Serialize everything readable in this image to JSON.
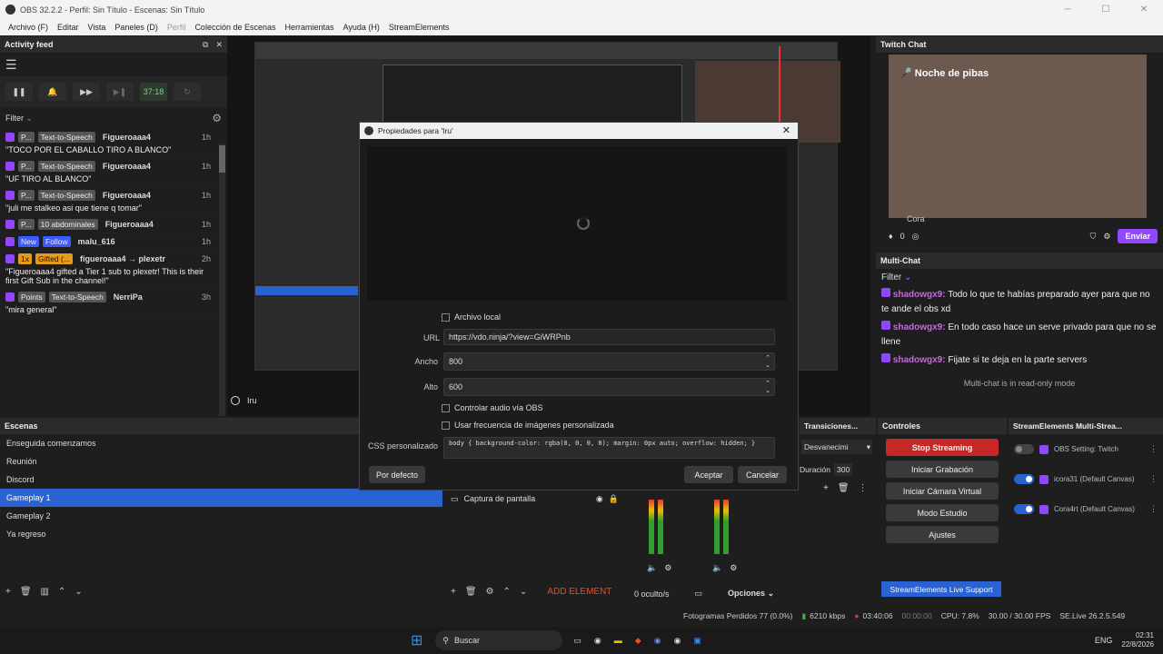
{
  "window": {
    "title": "OBS 32.2.2 - Perfil: Sin Título - Escenas: Sin Título"
  },
  "menu": [
    "Archivo (F)",
    "Editar",
    "Vista",
    "Paneles (D)",
    "Perfil",
    "Colección de Escenas",
    "Herramientas",
    "Ayuda (H)",
    "StreamElements"
  ],
  "activity": {
    "title": "Activity feed",
    "timer": "37:18",
    "filter": "Filter",
    "items": [
      {
        "p": "P...",
        "badge": "Text-to-Speech",
        "user": "Figueroaaa4",
        "time": "1h",
        "msg": "\"TOCO POR EL CABALLO TIRO A BLANCO\""
      },
      {
        "p": "P...",
        "badge": "Text-to-Speech",
        "user": "Figueroaaa4",
        "time": "1h",
        "msg": "\"UF TIRO AL BLANCO\""
      },
      {
        "p": "P...",
        "badge": "Text-to-Speech",
        "user": "Figueroaaa4",
        "time": "1h",
        "msg": "\"juli me stalkeo asi que tiene q tomar\""
      },
      {
        "p": "P...",
        "badge": "10 abdominales",
        "user": "Figueroaaa4",
        "time": "1h",
        "msg": ""
      },
      {
        "p": "New",
        "badge": "Follow",
        "user": "malu_616",
        "time": "1h",
        "msg": ""
      },
      {
        "p": "1x",
        "badge": "Gifted (...",
        "user": "figueroaaa4 → plexetr",
        "time": "2h",
        "msg": "\"Figueroaaa4 gifted a Tier 1 sub to plexetr! This is their first Gift Sub in the channel!\""
      },
      {
        "p": "Points",
        "badge": "Text-to-Speech",
        "user": "NerriPa",
        "time": "3h",
        "msg": "\"mira general\""
      }
    ]
  },
  "preview": {
    "source_label": "Iru"
  },
  "scenes": {
    "title": "Escenas",
    "items": [
      "Enseguida comenzamos",
      "Reunión",
      "Discord",
      "Gameplay 1",
      "Gameplay 2",
      "Ya regreso"
    ],
    "selected": 3
  },
  "sources": {
    "item": "Captura de pantalla",
    "add_element": "ADD ELEMENT",
    "hidden": "0 oculto/s",
    "options": "Opciones"
  },
  "dialog": {
    "title": "Propiedades para 'Iru'",
    "local_file": "Archivo local",
    "url_label": "URL",
    "url_value": "https://vdo.ninja/?view=GiWRPnb",
    "width_label": "Ancho",
    "width_value": "800",
    "height_label": "Alto",
    "height_value": "600",
    "control_audio": "Controlar audio vía OBS",
    "custom_fps": "Usar frecuencia de imágenes personalizada",
    "css_label": "CSS personalizado",
    "css_value": "body { background-color: rgba(0, 0, 0, 0); margin: 0px auto; overflow: hidden; }",
    "defaults": "Por defecto",
    "accept": "Aceptar",
    "cancel": "Cancelar"
  },
  "transitions": {
    "title": "Transiciones...",
    "type": "Desvanecimi",
    "duration_label": "Duración",
    "duration": "300"
  },
  "controls": {
    "title": "Controles",
    "stop_streaming": "Stop Streaming",
    "start_recording": "Iniciar Grabación",
    "virtual_cam": "Iniciar Cámara Virtual",
    "studio": "Modo Estudio",
    "settings": "Ajustes"
  },
  "se_multistream": {
    "title": "StreamElements Multi-Strea...",
    "items": [
      {
        "name": "OBS Setting: Twitch",
        "enabled": false
      },
      {
        "name": "icora31 (Default Canvas)",
        "enabled": true
      },
      {
        "name": "Cora4rt (Default Canvas)",
        "enabled": true
      }
    ],
    "live_support": "StreamElements Live Support"
  },
  "twitch_chat": {
    "title": "Twitch Chat",
    "channel": "Noche de pibas",
    "cam_label": "Cora",
    "count": "0",
    "send": "Enviar"
  },
  "multichat": {
    "title": "Multi-Chat",
    "filter": "Filter",
    "messages": [
      {
        "user": "shadowgx9:",
        "text": "Todo lo que te habías preparado ayer para que no te ande el obs xd"
      },
      {
        "user": "shadowgx9:",
        "text": "En todo caso hace un serve privado para que no se llene"
      },
      {
        "user": "shadowgx9:",
        "text": "Fijate si te deja en la parte servers"
      }
    ],
    "readonly": "Multi-chat is in read-only mode"
  },
  "status": {
    "dropped": "Fotogramas Perdidos 77 (0.0%)",
    "bitrate": "6210 kbps",
    "live_time": "03:40:06",
    "rec_time": "00:00:00",
    "cpu": "CPU: 7.8%",
    "fps": "30.00 / 30.00 FPS",
    "version": "SE.Live 26.2.5.549"
  },
  "taskbar": {
    "search": "Buscar",
    "lang": "ENG",
    "time": "02:31",
    "date": "22/8/2026"
  }
}
